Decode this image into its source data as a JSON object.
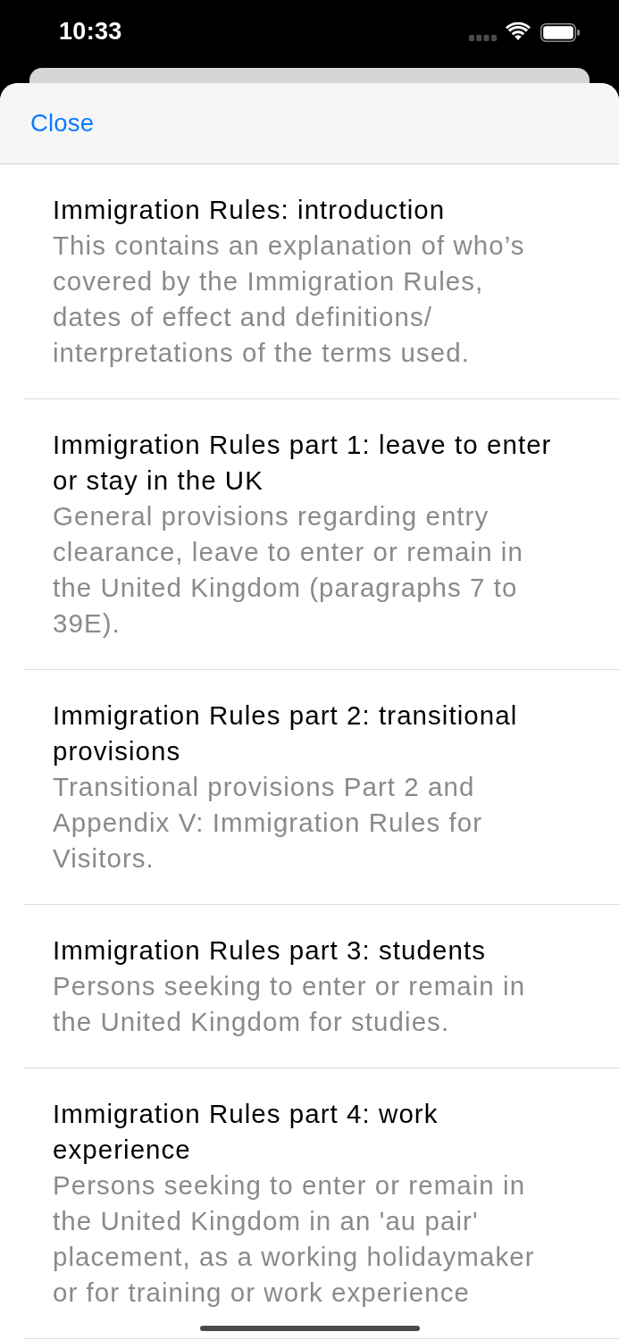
{
  "status_bar": {
    "time": "10:33"
  },
  "sheet": {
    "close_button": "Close"
  },
  "items": [
    {
      "title": "Immigration Rules: introduction",
      "description": "This contains an explanation of who’s covered by the Immigration Rules, dates of effect and definitions/ interpretations of the terms used."
    },
    {
      "title": "Immigration Rules part 1: leave to enter or stay in the UK",
      "description": "General provisions regarding entry clearance, leave to enter or remain in the United Kingdom (paragraphs 7 to 39E)."
    },
    {
      "title": "Immigration Rules part 2: transitional provisions",
      "description": "Transitional provisions Part 2 and Appendix V: Immigration Rules for Visitors."
    },
    {
      "title": "Immigration Rules part 3: students",
      "description": "Persons seeking to enter or remain in the United Kingdom for studies."
    },
    {
      "title": "Immigration Rules part 4: work experience",
      "description": "Persons seeking to enter or remain in the United Kingdom in an 'au pair' placement, as a working holidaymaker or for training or work experience"
    }
  ]
}
